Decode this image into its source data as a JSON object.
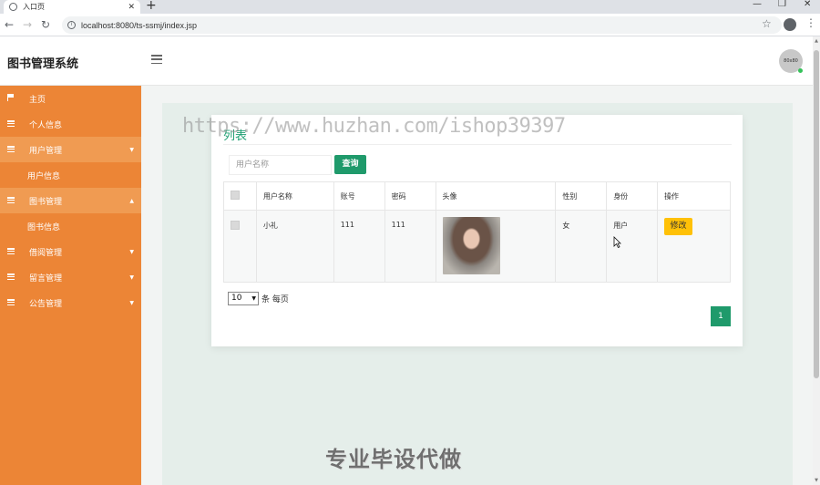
{
  "browser": {
    "tab_title": "入口页",
    "tab_close": "✕",
    "new_tab": "+",
    "url": "localhost:8080/ts-ssmj/index.jsp",
    "win_min": "—",
    "win_restore": "❐",
    "win_close": "✕"
  },
  "header": {
    "app_title": "图书管理系统",
    "avatar_text": "80x80"
  },
  "sidebar": {
    "items": [
      {
        "label": "主页",
        "icon": "flag-icon"
      },
      {
        "label": "个人信息",
        "icon": "list-icon"
      },
      {
        "label": "用户管理",
        "icon": "list-icon",
        "caret": "▼"
      },
      {
        "label": "用户信息"
      },
      {
        "label": "图书管理",
        "icon": "list-icon",
        "caret": "▲"
      },
      {
        "label": "图书信息"
      },
      {
        "label": "借阅管理",
        "icon": "list-icon",
        "caret": "▼"
      },
      {
        "label": "留言管理",
        "icon": "list-icon",
        "caret": "▼"
      },
      {
        "label": "公告管理",
        "icon": "list-icon",
        "caret": "▼"
      }
    ]
  },
  "main": {
    "card_title": "列表",
    "search_placeholder": "用户名称",
    "search_button": "查询",
    "table": {
      "headers": [
        "用户名称",
        "账号",
        "密码",
        "头像",
        "性别",
        "身份",
        "操作"
      ],
      "rows": [
        {
          "username": "小礼",
          "account": "111",
          "password": "111",
          "gender": "女",
          "role": "用户",
          "action": "修改"
        }
      ]
    },
    "page_size": "10",
    "page_size_suffix": "条 每页",
    "current_page": "1"
  },
  "watermarks": {
    "url_text": "https://www.huzhan.com/ishop39397",
    "slogan": "专业毕设代做"
  },
  "colors": {
    "sidebar": "#ec8536",
    "primary": "#1f9a6b",
    "edit_button": "#ffc107"
  }
}
